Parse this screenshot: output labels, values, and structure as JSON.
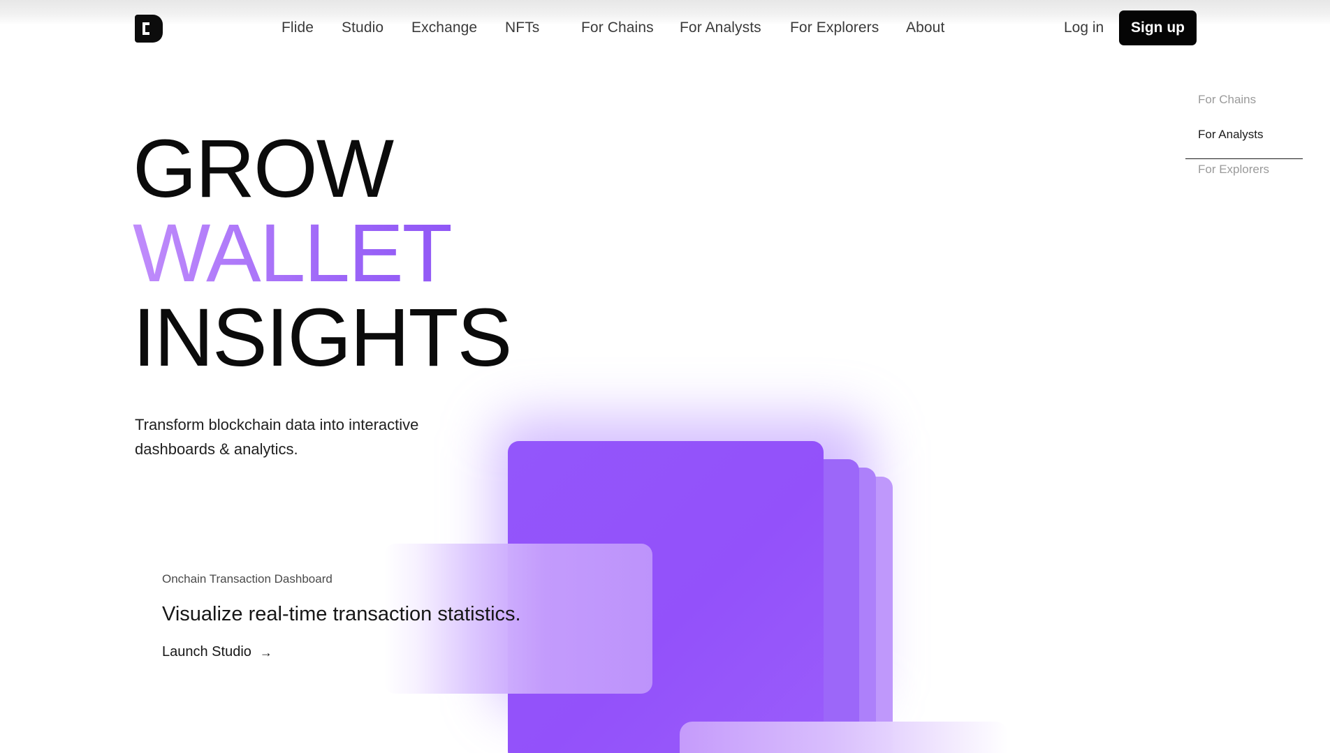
{
  "nav": {
    "items": [
      {
        "label": "Flide"
      },
      {
        "label": "Studio"
      },
      {
        "label": "Exchange"
      },
      {
        "label": "NFTs"
      },
      {
        "label": "For Chains"
      },
      {
        "label": "For Analysts"
      },
      {
        "label": "For Explorers"
      },
      {
        "label": "About"
      }
    ],
    "login_label": "Log in",
    "signup_label": "Sign up"
  },
  "side_menu": {
    "items": [
      {
        "label": "For Chains",
        "active": false
      },
      {
        "label": "For Analysts",
        "active": true
      },
      {
        "label": "For Explorers",
        "active": false
      }
    ]
  },
  "hero": {
    "line1": "GROW",
    "line2": "WALLET",
    "line3": "INSIGHTS",
    "subtitle": "Transform blockchain data into interactive dashboards & analytics."
  },
  "feature_card": {
    "label": "Onchain Transaction Dashboard",
    "headline": "Visualize real-time transaction statistics.",
    "link_label": "Launch Studio",
    "link_icon": "arrow-right-icon"
  },
  "colors": {
    "accent_purple": "#9b5cff",
    "accent_light": "#c08cfb",
    "button_bg": "#050505",
    "text_dark": "#0b0b0b",
    "text_muted": "#9a9a9a"
  }
}
